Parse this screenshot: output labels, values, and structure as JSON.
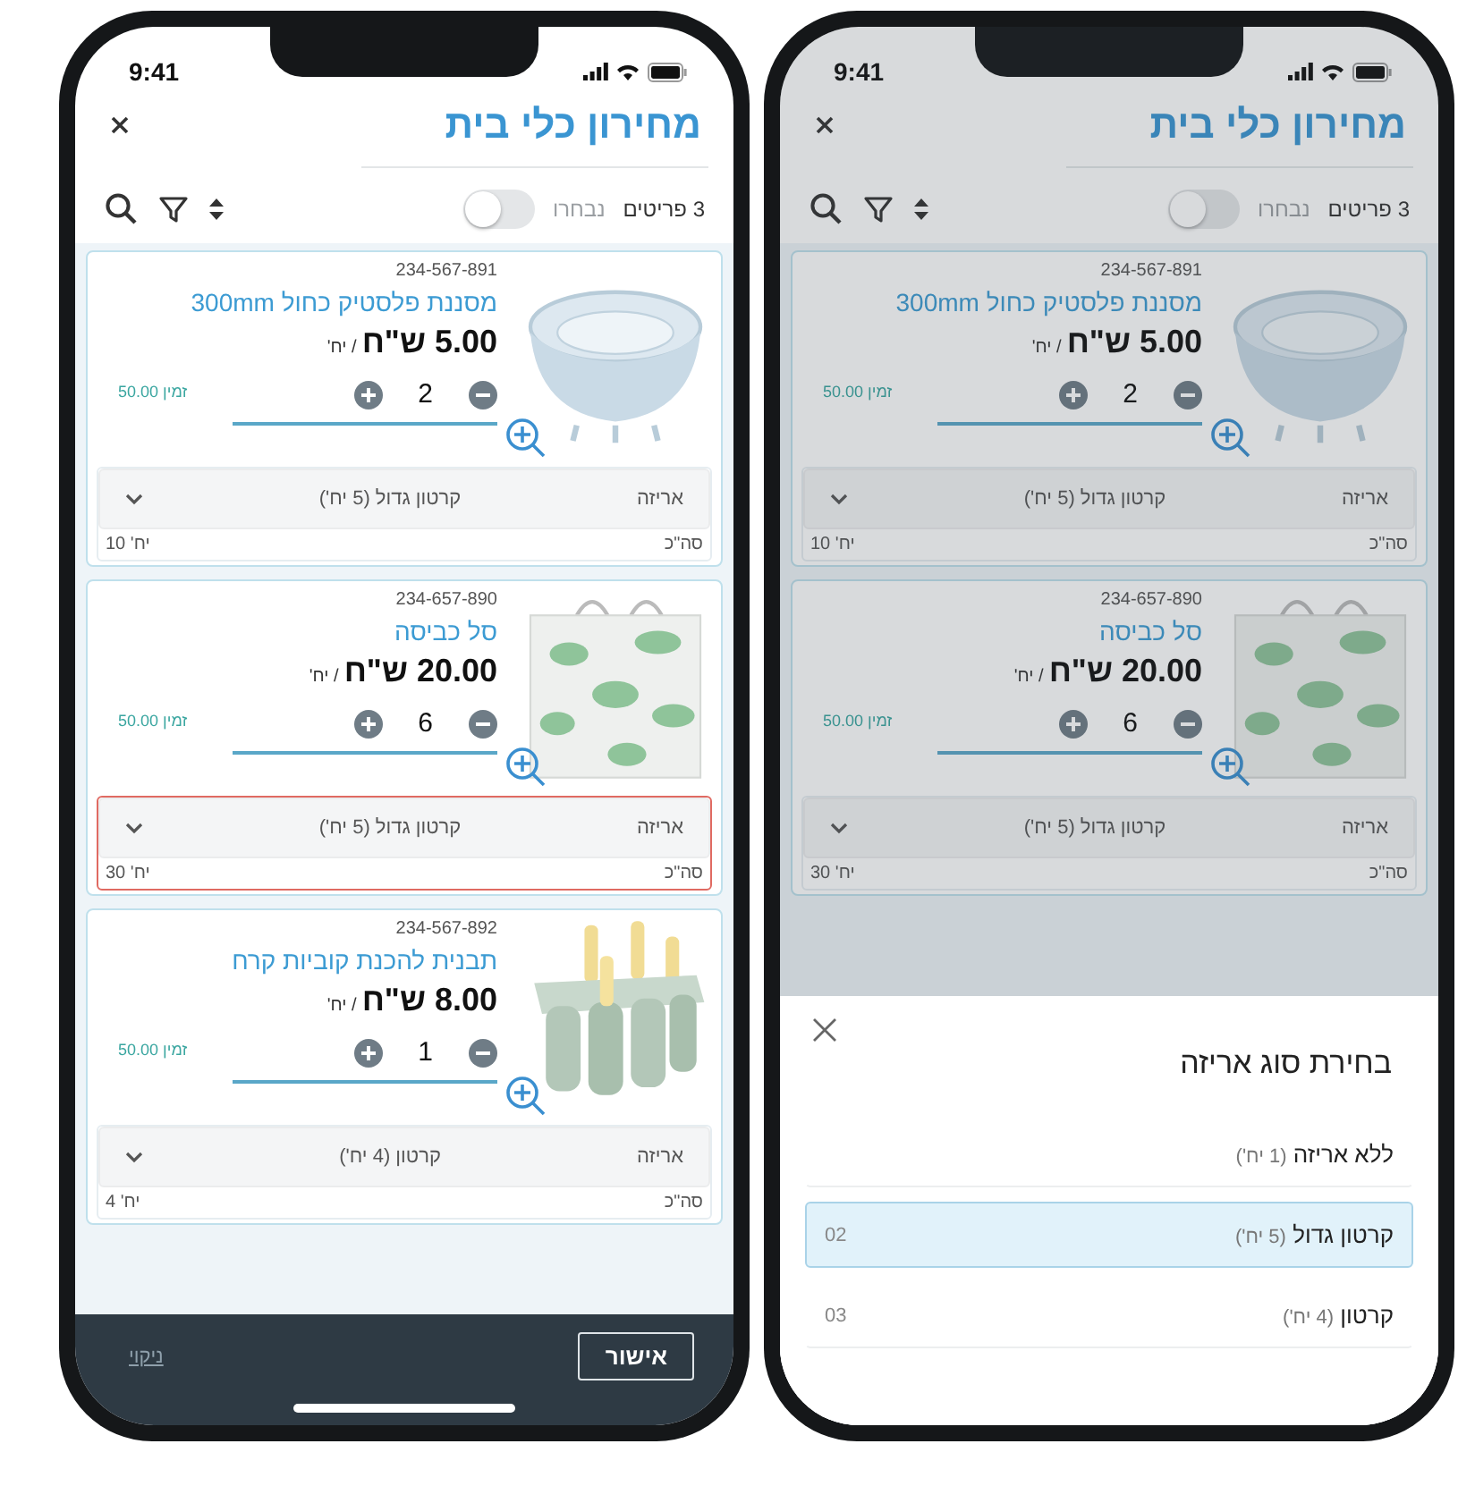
{
  "phones": [
    {
      "status_bar": {
        "time": "9:41"
      },
      "header": {
        "title": "מחירון כלי בית"
      },
      "toolbar": {
        "count": "3 פריטים",
        "toggle_label": "נבחרו",
        "toggle_on": false
      },
      "products": [
        {
          "sku": "234-567-891",
          "name": "מסננת פלסטיק כחול 300mm",
          "price": "5.00 ש\"ח",
          "unit": "/ יח'",
          "quantity": "2",
          "stock": "זמין 50.00",
          "packaging_label": "אריזה",
          "packaging_value": "קרטון גדול (5 יח')",
          "total_label": "סה\"כ",
          "total_value": "יח' 10",
          "invalid": false
        },
        {
          "sku": "234-657-890",
          "name": "סל כביסה",
          "price": "20.00 ש\"ח",
          "unit": "/ יח'",
          "quantity": "6",
          "stock": "זמין 50.00",
          "packaging_label": "אריזה",
          "packaging_value": "קרטון גדול (5 יח')",
          "total_label": "סה\"כ",
          "total_value": "יח' 30",
          "invalid": false
        }
      ],
      "sheet": {
        "title": "בחירת סוג אריזה",
        "options": [
          {
            "label": "ללא אריזה",
            "note": "(1 יח')",
            "selected": false
          },
          {
            "label": "קרטון גדול",
            "note": "(5 יח')",
            "code": "02",
            "selected": true
          },
          {
            "label": "קרטון",
            "note": "(4 יח')",
            "code": "03",
            "selected": false
          }
        ]
      }
    },
    {
      "status_bar": {
        "time": "9:41"
      },
      "header": {
        "title": "מחירון כלי בית"
      },
      "toolbar": {
        "count": "3 פריטים",
        "toggle_label": "נבחרו",
        "toggle_on": false
      },
      "products": [
        {
          "sku": "234-567-891",
          "name": "מסננת פלסטיק כחול 300mm",
          "price": "5.00 ש\"ח",
          "unit": "/ יח'",
          "quantity": "2",
          "stock": "זמין 50.00",
          "packaging_label": "אריזה",
          "packaging_value": "קרטון גדול (5 יח')",
          "total_label": "סה\"כ",
          "total_value": "יח' 10",
          "invalid": false
        },
        {
          "sku": "234-657-890",
          "name": "סל כביסה",
          "price": "20.00 ש\"ח",
          "unit": "/ יח'",
          "quantity": "6",
          "stock": "זמין 50.00",
          "packaging_label": "אריזה",
          "packaging_value": "קרטון גדול (5 יח')",
          "total_label": "סה\"כ",
          "total_value": "יח' 30",
          "invalid": true
        },
        {
          "sku": "234-567-892",
          "name": "תבנית להכנת קוביות קרח",
          "price": "8.00 ש\"ח",
          "unit": "/ יח'",
          "quantity": "1",
          "stock": "זמין 50.00",
          "packaging_label": "אריזה",
          "packaging_value": "קרטון (4 יח')",
          "total_label": "סה\"כ",
          "total_value": "יח' 4",
          "invalid": false
        }
      ],
      "footer": {
        "confirm": "אישור",
        "clear": "ניקוי"
      }
    }
  ]
}
